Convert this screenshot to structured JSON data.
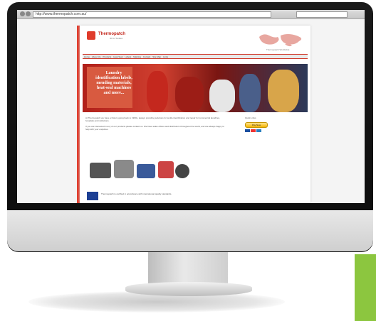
{
  "browser": {
    "url": "http://www.thermopatch.com.au/"
  },
  "site": {
    "logo_name": "Thermopatch",
    "logo_tagline": "ID for Textiles",
    "map_caption": "Thermopatch Worldwide",
    "nav_items": [
      "Home",
      "About Us",
      "Products",
      "Heat Seal",
      "Labels",
      "Marking",
      "Contact",
      "Site Map",
      "Links"
    ],
    "hero_text": "Laundry identification labels, mending materials, heat-seal machines and more..."
  },
  "content": {
    "paragraph_1": "At Thermopatch we have a history going back to 1960s, always providing solutions for textile identification and repair for commercial laundries, hospitals and institutions.",
    "paragraph_2": "If you are interested in any of our products please contact us. We have sales offices and distributors throughout the world, and are always happy to help with your enquiries.",
    "eu_text": "Thermopatch is certified in accordance with international quality standards."
  },
  "sidebar": {
    "title": "Quick Links",
    "paypal_label": "Pay Now"
  },
  "colors": {
    "brand_red": "#e03b2b",
    "accent_green": "#8cc63f"
  }
}
